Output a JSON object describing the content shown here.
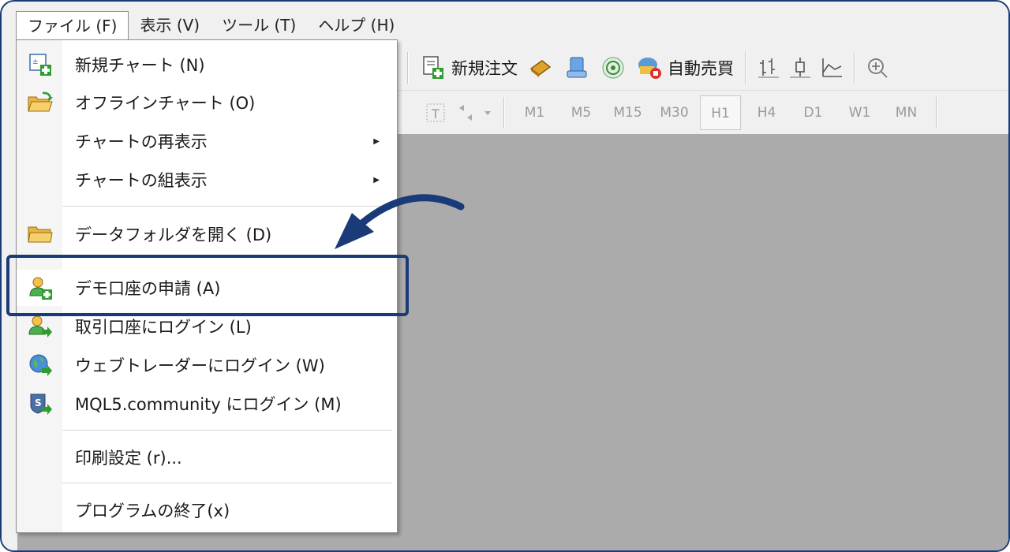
{
  "menubar": {
    "file": "ファイル (F)",
    "view": "表示 (V)",
    "tools": "ツール (T)",
    "help": "ヘルプ (H)"
  },
  "toolbar": {
    "new_order": "新規注文",
    "auto_trade": "自動売買"
  },
  "timeframes": {
    "items": [
      "M1",
      "M5",
      "M15",
      "M30",
      "H1",
      "H4",
      "D1",
      "W1",
      "MN"
    ],
    "active": "H1"
  },
  "file_menu": {
    "items": [
      {
        "label": "新規チャート (N)",
        "icon": "new-chart-icon"
      },
      {
        "label": "オフラインチャート (O)",
        "icon": "open-folder-icon"
      },
      {
        "label": "チャートの再表示",
        "submenu": true
      },
      {
        "label": "チャートの組表示",
        "submenu": true
      },
      {
        "label": "データフォルダを開く (D)",
        "icon": "folder-icon"
      },
      {
        "label": "デモ口座の申請 (A)",
        "icon": "user-add-icon"
      },
      {
        "label": "取引口座にログイン (L)",
        "icon": "user-login-icon"
      },
      {
        "label": "ウェブトレーダーにログイン (W)",
        "icon": "globe-login-icon"
      },
      {
        "label": "MQL5.community にログイン (M)",
        "icon": "mql5-login-icon"
      },
      {
        "label": "印刷設定 (r)..."
      },
      {
        "label": "プログラムの終了(x)"
      }
    ]
  },
  "colors": {
    "highlight": "#1a3b78",
    "workspace": "#ababab"
  }
}
